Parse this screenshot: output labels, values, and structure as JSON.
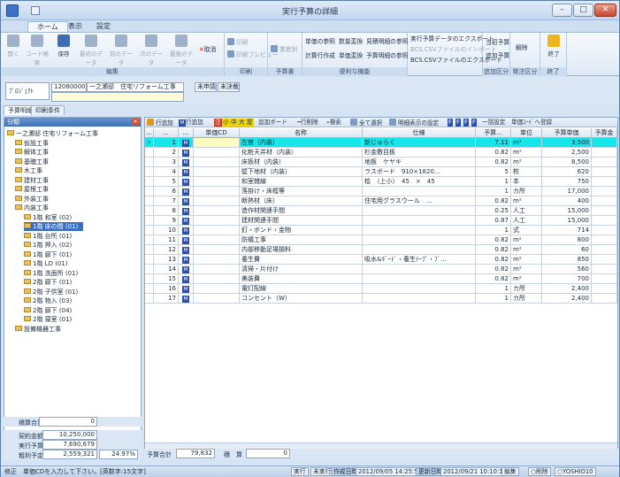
{
  "window": {
    "title": "実行予算の詳細",
    "min": "–",
    "max": "□",
    "close": "✕"
  },
  "tabs": [
    "ホーム",
    "表示",
    "設定"
  ],
  "ribbon": {
    "edit": {
      "label": "編集",
      "buttons": [
        "開く",
        "コード検索",
        "保存",
        "最初のデータ",
        "前のデータ",
        "次のデータ",
        "最後のデータ",
        "取消"
      ]
    },
    "print": {
      "label": "印刷",
      "buttons": [
        "印刷",
        "印刷プレビュー"
      ]
    },
    "budget": {
      "label": "予算書",
      "buttons": [
        "業者別"
      ]
    },
    "convenience": {
      "label": "便利な機能",
      "buttons": [
        "単価の参照",
        "数量変換",
        "見積明細の参照",
        "計算行作成",
        "単価変換",
        "予算明細の参照"
      ]
    },
    "export": {
      "buttons": [
        "実行予算データのエクスポート",
        "BCS.CSVファイルのインポート",
        "BCS.CSVファイルのエクスポート"
      ]
    },
    "add": {
      "label": "追加区分",
      "buttons": [
        "当初予算",
        "追加予算"
      ]
    },
    "order": {
      "label": "発注区分",
      "buttons": [
        "解除"
      ]
    },
    "end": {
      "label": "終了",
      "buttons": [
        "終了"
      ]
    }
  },
  "project": {
    "label": "ﾌﾟﾛｼﾞｪｸﾄ",
    "code": "1208000002",
    "name": "一之瀬邸　住宅リフォーム工事",
    "status1": "未申請",
    "status2": "未決裁"
  },
  "subtabs": [
    "予算明細",
    "印刷条件"
  ],
  "tree": {
    "header": "分類",
    "root": "一之瀬邸 住宅リフォーム工事",
    "items": [
      "仮設工事",
      "解体工事",
      "基礎工事",
      "木工事",
      "建材工事",
      "屋根工事",
      "外装工事",
      "内装工事"
    ],
    "sub": [
      "1階 和室 (02)",
      "1階 床の間 (01)",
      "1階 台所 (01)",
      "1階 押入 (02)",
      "1階 廊下 (01)",
      "1階 LD (01)",
      "1階 洗面所 (01)",
      "2階 廊下 (01)",
      "2階 子供室 (01)",
      "2階 物入 (03)",
      "2階 廊下 (04)",
      "2階 寝室 (01)"
    ],
    "last": "設備機器工事"
  },
  "left_summary": {
    "total_label": "積算合計",
    "total": "0",
    "contract_label": "契約金額",
    "contract": "10,250,000",
    "exec_label": "実行予算",
    "exec": "7,690,679",
    "profit_label": "粗利予定",
    "profit": "2,559,321",
    "rate": "24.97%"
  },
  "grid_toolbar": [
    "行追加",
    "行追加",
    "注",
    "小",
    "中",
    "大",
    "屋",
    "追加ボード",
    "行削除",
    "検索",
    "全て選択",
    "明細表示の設定",
    "F",
    "F",
    "F",
    "F",
    "一括設定",
    "単価ｺｰﾄﾞへ登録"
  ],
  "headers": [
    "...",
    "...",
    "...",
    "単価CD",
    "名称",
    "仕様",
    "予算...",
    "単位",
    "予算単価",
    "予算金"
  ],
  "rows": [
    [
      "1",
      "",
      "左官（内装）",
      "新じゅらく",
      "7.11",
      "m²",
      "3,500"
    ],
    [
      "2",
      "",
      "化粧天井材（内装）",
      "杉金敷目板",
      "0.82",
      "m²",
      "2,500"
    ],
    [
      "3",
      "",
      "床板材（内装）",
      "地板　ケヤキ",
      "0.82",
      "m²",
      "8,500"
    ],
    [
      "4",
      "",
      "壁下地材（内装）",
      "ラスボード　910×1820...",
      "5",
      "枚",
      "620"
    ],
    [
      "5",
      "",
      "和室雑線",
      "桧　（上小）　45　×　45",
      "1",
      "本",
      "750"
    ],
    [
      "6",
      "",
      "落掛け・床框等",
      "",
      "1",
      "カ所",
      "17,000"
    ],
    [
      "7",
      "",
      "断熱材（床）",
      "住宅用グラスウール　...",
      "0.82",
      "m²",
      "400"
    ],
    [
      "8",
      "",
      "造作材関連手間",
      "",
      "0.25",
      "人工",
      "15,000"
    ],
    [
      "9",
      "",
      "建材関連手間",
      "",
      "0.87",
      "人工",
      "15,000"
    ],
    [
      "10",
      "",
      "釘・ボンド・金物",
      "",
      "1",
      "式",
      "714"
    ],
    [
      "11",
      "",
      "防蟻工事",
      "",
      "0.82",
      "m²",
      "800"
    ],
    [
      "12",
      "",
      "内部移動足場損料",
      "",
      "0.82",
      "m²",
      "60"
    ],
    [
      "13",
      "",
      "養生費",
      "吸水&ﾎﾞｰﾄﾞ・養生ﾃｰﾌﾟ・ﾌﾞ...",
      "0.82",
      "m²",
      "850"
    ],
    [
      "14",
      "",
      "清掃・片付け",
      "",
      "0.82",
      "m²",
      "560"
    ],
    [
      "15",
      "",
      "美装費",
      "",
      "0.82",
      "m²",
      "700"
    ],
    [
      "16",
      "",
      "電灯配線",
      "",
      "1",
      "カ所",
      "2,400"
    ],
    [
      "17",
      "",
      "コンセント（W）",
      "",
      "1",
      "カ所",
      "2,400"
    ]
  ],
  "footer": {
    "total_label": "予算合計",
    "total": "79,832",
    "estimate_label": "積　算",
    "estimate": "0"
  },
  "status": {
    "message": "修正　単価CDを入力して下さい。[英数字:15文字]",
    "exec": "実行",
    "not_exec": "未実行",
    "created_label": "作成日時",
    "created": "2012/09/05 14:25:58",
    "updated_label": "更新日時",
    "updated": "2012/09/21 10:10:14",
    "edit": "編集",
    "delete": "削除",
    "user": "YOSHIO10"
  }
}
